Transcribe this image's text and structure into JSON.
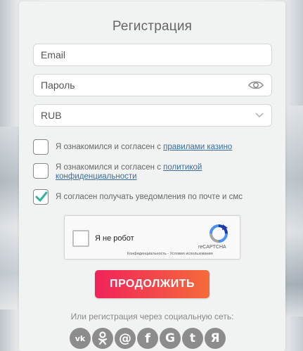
{
  "form": {
    "title": "Регистрация",
    "email_placeholder": "Email",
    "password_placeholder": "Пароль",
    "currency_value": "RUB"
  },
  "checkboxes": [
    {
      "text": "Я ознакомился и согласен с ",
      "link": "правилами казино",
      "checked": false
    },
    {
      "text": "Я ознакомился и согласен с ",
      "link": "политикой конфиденциальности",
      "checked": false
    },
    {
      "text": "Я согласен получать уведомления по почте и смс",
      "link": "",
      "checked": true
    }
  ],
  "captcha": {
    "label": "Я не робот",
    "brand": "reCAPTCHA",
    "links": "Конфиденциальность - Условия использования"
  },
  "submit_label": "ПРОДОЛЖИТЬ",
  "social": {
    "title": "Или регистрация через социальную сеть:",
    "icons": [
      {
        "name": "vk-icon",
        "glyph": "vk"
      },
      {
        "name": "odnoklassniki-icon",
        "glyph": "ok"
      },
      {
        "name": "mail-at-icon",
        "glyph": "@"
      },
      {
        "name": "facebook-icon",
        "glyph": "f"
      },
      {
        "name": "google-icon",
        "glyph": "G"
      },
      {
        "name": "twitter-icon",
        "glyph": "t"
      },
      {
        "name": "yandex-icon",
        "glyph": "Я"
      }
    ]
  },
  "colors": {
    "accent_start": "#f0235a",
    "accent_end": "#f56a3b",
    "check_green": "#2fb3a0",
    "link": "#3a6e9e"
  }
}
